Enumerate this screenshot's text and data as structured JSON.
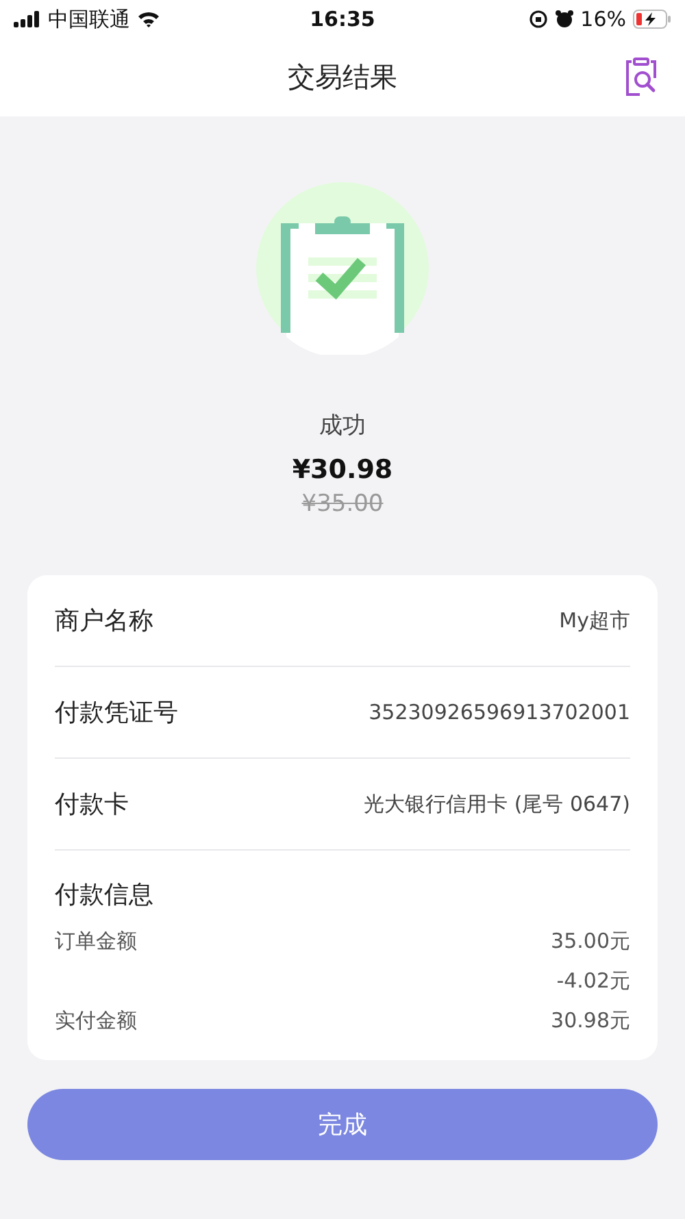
{
  "status_bar": {
    "carrier": "中国联通",
    "time": "16:35",
    "battery": "16%"
  },
  "nav": {
    "title": "交易结果"
  },
  "result": {
    "status": "成功",
    "amount": "¥30.98",
    "original_amount": "¥35.00"
  },
  "details": [
    {
      "label": "商户名称",
      "value": "My超市"
    },
    {
      "label": "付款凭证号",
      "value": "35230926596913702001"
    },
    {
      "label": "付款卡",
      "value": "光大银行信用卡 (尾号 0647)"
    }
  ],
  "payment_info": {
    "title": "付款信息",
    "rows": [
      {
        "label": "订单金额",
        "value": "35.00元"
      },
      {
        "value": "-4.02元"
      },
      {
        "label": "实付金额",
        "value": "30.98元"
      }
    ]
  },
  "done_button": "完成"
}
